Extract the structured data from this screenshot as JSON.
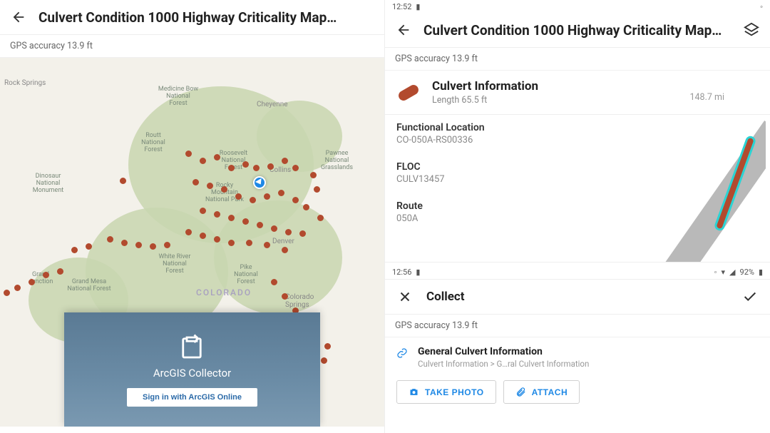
{
  "left": {
    "title": "Culvert Condition 1000 Highway Criticality Map…",
    "gps": "GPS accuracy 13.9 ft",
    "state": "COLORADO",
    "cities": {
      "rock_springs": "Rock Springs",
      "cheyenne": "Cheyenne",
      "denver": "Denver",
      "colorado_springs": "Colorado Springs",
      "collins": "Collins"
    },
    "forests": {
      "medicine_bow": "Medicine Bow National Forest",
      "routt": "Routt National Forest",
      "roosevelt": "Roosevelt National Forest",
      "rocky_mountain": "Rocky Mountain National Park",
      "white_river": "White River National Forest",
      "pike": "Pike National Forest",
      "grand_mesa": "Grand Mesa National Forest",
      "dinosaur": "Dinosaur National Monument",
      "pawnee": "Pawnee National Grasslands",
      "grand_junction": "Grand Junction"
    },
    "login": {
      "product": "ArcGIS Collector",
      "signin": "Sign in with ArcGIS Online"
    }
  },
  "right": {
    "status_time_top": "12:52",
    "title": "Culvert Condition 1000 Highway Criticality Map…",
    "gps": "GPS accuracy 13.9 ft",
    "feature": {
      "title": "Culvert Information",
      "subtitle": "Length 65.5 ft",
      "distance": "148.7 mi"
    },
    "attrs": {
      "functional_location_label": "Functional Location",
      "functional_location_value": "CO-050A-RS00336",
      "floc_label": "FLOC",
      "floc_value": "CULV13457",
      "route_label": "Route",
      "route_value": "050A"
    },
    "status_time_bottom": "12:56",
    "battery": "92%",
    "collect": {
      "title": "Collect",
      "gps": "GPS accuracy 13.9 ft",
      "feature_title": "General Culvert Information",
      "feature_path": "Culvert Information > G…ral Culvert Information",
      "take_photo": "TAKE PHOTO",
      "attach": "ATTACH"
    }
  }
}
